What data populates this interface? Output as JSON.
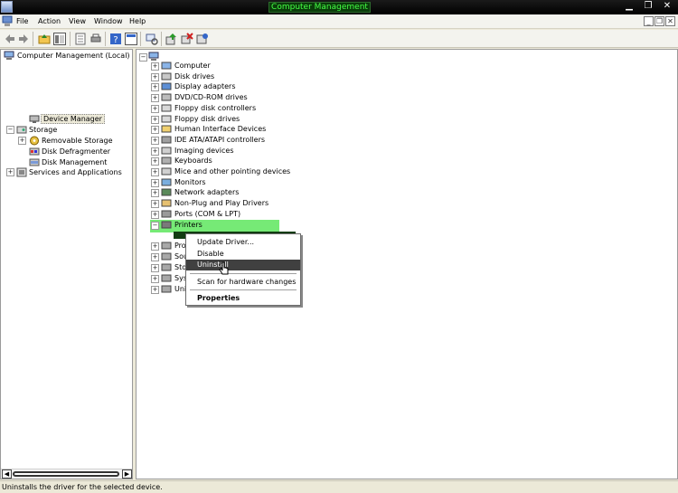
{
  "window": {
    "title": "Computer Management"
  },
  "menu": {
    "items": [
      "File",
      "Action",
      "View",
      "Window",
      "Help"
    ]
  },
  "left_tree": {
    "root": "Computer Management (Local)",
    "nodes": {
      "device_manager": "Device Manager",
      "storage": "Storage",
      "removable_storage": "Removable Storage",
      "disk_defragmenter": "Disk Defragmenter",
      "disk_management": "Disk Management",
      "services_apps": "Services and Applications"
    }
  },
  "devices": {
    "items": [
      "Computer",
      "Disk drives",
      "Display adapters",
      "DVD/CD-ROM drives",
      "Floppy disk controllers",
      "Floppy disk drives",
      "Human Interface Devices",
      "IDE ATA/ATAPI controllers",
      "Imaging devices",
      "Keyboards",
      "Mice and other pointing devices",
      "Monitors",
      "Network adapters",
      "Non-Plug and Play Drivers",
      "Ports (COM & LPT)",
      "Printers"
    ],
    "partial_below": [
      "Pro",
      "Sou",
      "Sto",
      "Sys",
      "Uni"
    ]
  },
  "context_menu": {
    "update_driver": "Update Driver...",
    "disable": "Disable",
    "uninstall": "Uninstall",
    "scan": "Scan for hardware changes",
    "properties": "Properties"
  },
  "status": {
    "text": "Uninstalls the driver for the selected device."
  },
  "colors": {
    "highlight": "#76ea76",
    "title_text": "#46ff46",
    "menu_active": "#404040"
  }
}
